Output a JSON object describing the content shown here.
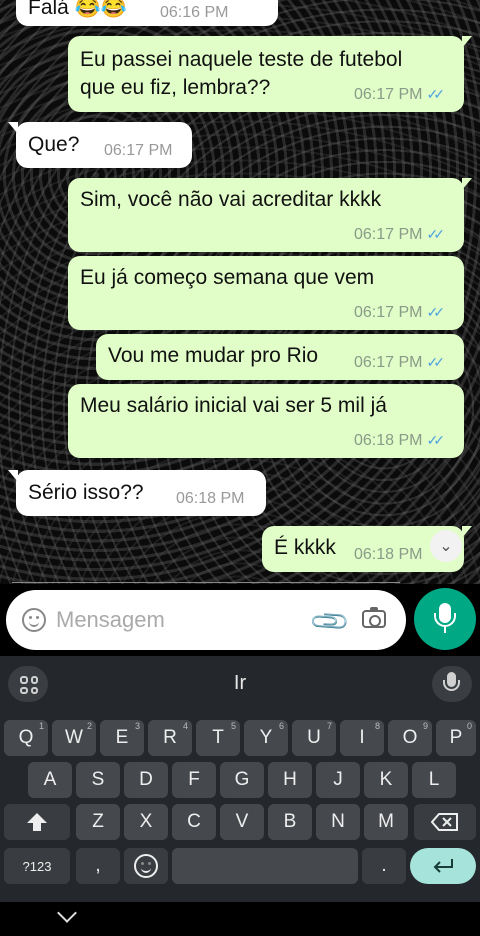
{
  "messages": [
    {
      "direction": "in",
      "text": "Falá 😂😂",
      "time": "06:16 PM"
    },
    {
      "direction": "out",
      "lines": [
        "Eu passei naquele teste de futebol",
        "que eu fiz, lembra??"
      ],
      "time": "06:17 PM"
    },
    {
      "direction": "in",
      "text": "Que?",
      "time": "06:17 PM"
    },
    {
      "direction": "out",
      "text": "Sim, você não vai acreditar kkkk",
      "time": "06:17 PM"
    },
    {
      "direction": "out",
      "text": "Eu já começo semana que vem",
      "time": "06:17 PM"
    },
    {
      "direction": "out",
      "text": "Vou me mudar pro Rio",
      "time": "06:17 PM"
    },
    {
      "direction": "out",
      "text": "Meu salário inicial vai ser 5 mil já",
      "time": "06:18 PM"
    },
    {
      "direction": "in",
      "text": "Sério isso??",
      "time": "06:18 PM"
    },
    {
      "direction": "out",
      "text": "É kkkk",
      "time": "06:18 PM"
    }
  ],
  "composer": {
    "placeholder": "Mensagem"
  },
  "keyboard": {
    "suggestion": "Ir",
    "row1": [
      [
        "Q",
        "1"
      ],
      [
        "W",
        "2"
      ],
      [
        "E",
        "3"
      ],
      [
        "R",
        "4"
      ],
      [
        "T",
        "5"
      ],
      [
        "Y",
        "6"
      ],
      [
        "U",
        "7"
      ],
      [
        "I",
        "8"
      ],
      [
        "O",
        "9"
      ],
      [
        "P",
        "0"
      ]
    ],
    "row2": [
      "A",
      "S",
      "D",
      "F",
      "G",
      "H",
      "J",
      "K",
      "L"
    ],
    "row3": [
      "Z",
      "X",
      "C",
      "V",
      "B",
      "N",
      "M"
    ],
    "symbols_label": "?123",
    "comma": ",",
    "period": "."
  },
  "icons": {
    "read_ticks": "double-check-icon",
    "scroll_down": "chevrons-down-icon",
    "emoji": "emoji-icon",
    "attach": "paperclip-icon",
    "camera": "camera-icon",
    "mic": "microphone-icon"
  },
  "colors": {
    "outgoing_bubble": "#e1fec8",
    "incoming_bubble": "#ffffff",
    "send_button": "#00a884",
    "ticks": "#4fa3e0"
  }
}
